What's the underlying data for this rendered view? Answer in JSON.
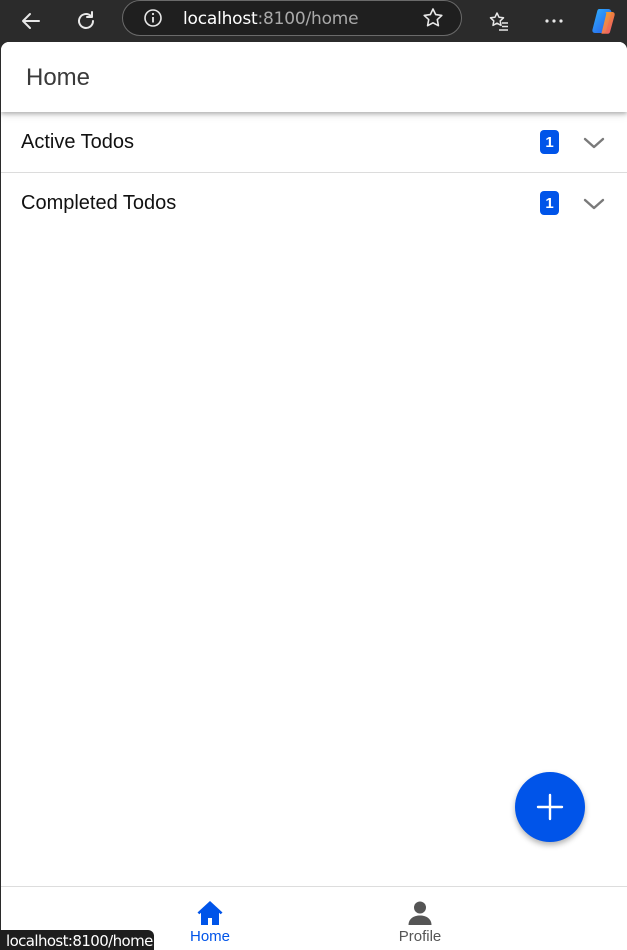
{
  "browser": {
    "url_host": "localhost",
    "url_rest": ":8100/home",
    "status_url": "localhost:8100/home",
    "icons": [
      "back-arrow-icon",
      "reload-icon",
      "info-icon",
      "star-icon",
      "favorites-icon",
      "more-icon",
      "copilot-icon"
    ]
  },
  "toolbar": {
    "title": "Home"
  },
  "accordions": [
    {
      "label": "Active Todos",
      "count": "1"
    },
    {
      "label": "Completed Todos",
      "count": "1"
    }
  ],
  "fab": {
    "icon": "add-icon"
  },
  "tabs": [
    {
      "label": "Home",
      "icon": "home-icon",
      "selected": true
    },
    {
      "label": "Profile",
      "icon": "person-icon",
      "selected": false
    }
  ],
  "colors": {
    "primary": "#0054e9",
    "chrome": "#2b2b2b"
  }
}
